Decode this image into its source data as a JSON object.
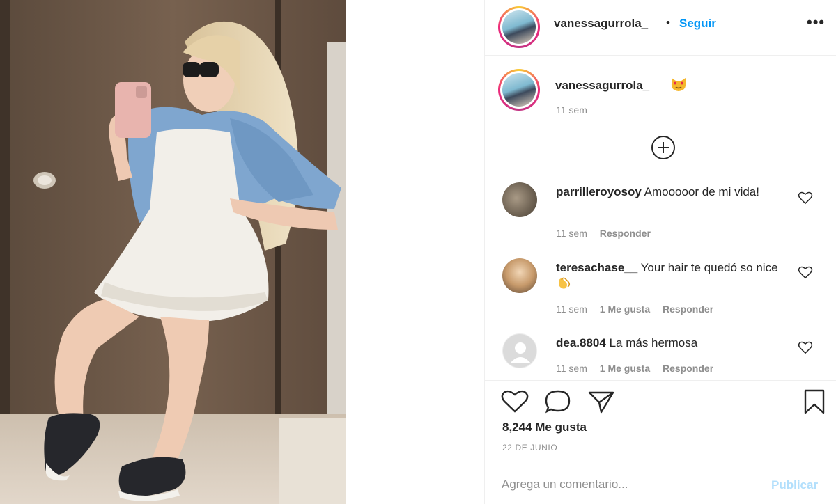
{
  "post": {
    "author": "vanessagurrola_",
    "follow_separator": "•",
    "follow_label": "Seguir",
    "more_label": "•••"
  },
  "caption": {
    "username": "vanessagurrola_",
    "emoji_icon": "heart-eyes-cat-icon",
    "time": "11 sem"
  },
  "load_more_icon": "plus-circle-icon",
  "comments": [
    {
      "username": "parrilleroyosoy",
      "text": "Amooooor de mi vida!",
      "time": "11 sem",
      "likes": "",
      "reply_label": "Responder"
    },
    {
      "username": "teresachase__",
      "text": "Your hair te quedó so nice",
      "emoji_icon": "clapping-hands-icon",
      "time": "11 sem",
      "likes": "1 Me gusta",
      "reply_label": "Responder"
    },
    {
      "username": "dea.8804",
      "text": "La más hermosa",
      "time": "11 sem",
      "likes": "1 Me gusta",
      "reply_label": "Responder"
    }
  ],
  "actions": {
    "like_icon": "heart-icon",
    "comment_icon": "speech-bubble-icon",
    "share_icon": "paper-plane-icon",
    "save_icon": "bookmark-icon"
  },
  "likes_count": "8,244 Me gusta",
  "date": "22 DE JUNIO",
  "comment_box": {
    "placeholder": "Agrega un comentario...",
    "publish_label": "Publicar"
  },
  "colors": {
    "link_blue": "#0095f6",
    "publish_disabled": "#b2dffc",
    "muted_text": "#8e8e8e",
    "primary_text": "#262626"
  }
}
